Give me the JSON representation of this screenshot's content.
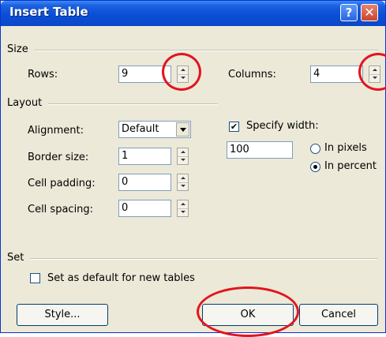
{
  "window": {
    "title": "Insert Table",
    "help_glyph": "?",
    "close_glyph": "✕"
  },
  "size": {
    "label": "Size",
    "rows_label": "Rows:",
    "rows_value": "9",
    "columns_label": "Columns:",
    "columns_value": "4"
  },
  "layout": {
    "label": "Layout",
    "alignment_label": "Alignment:",
    "alignment_value": "Default",
    "border_label": "Border size:",
    "border_value": "1",
    "padding_label": "Cell padding:",
    "padding_value": "0",
    "spacing_label": "Cell spacing:",
    "spacing_value": "0",
    "specify_width_label": "Specify width:",
    "specify_width_checked": true,
    "width_value": "100",
    "in_pixels_label": "In pixels",
    "in_percent_label": "In percent",
    "selected_unit": "In percent"
  },
  "set": {
    "label": "Set",
    "default_label": "Set as default for new tables",
    "default_checked": false
  },
  "buttons": {
    "style": "Style...",
    "ok": "OK",
    "cancel": "Cancel"
  },
  "colors": {
    "titlebar": "#0a4fd6",
    "face": "#ece9d8",
    "highlight": "#e3141f"
  }
}
